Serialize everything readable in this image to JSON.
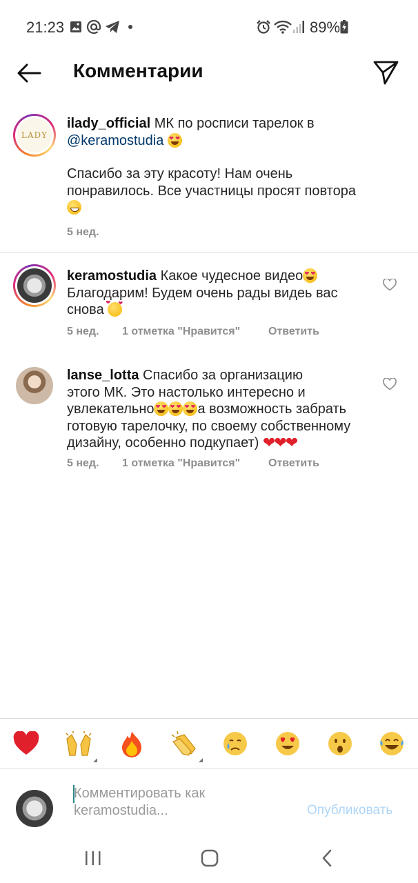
{
  "status_bar": {
    "time": "21:23",
    "battery": "89%",
    "icons": [
      "gallery-icon",
      "at-icon",
      "telegram-icon",
      "dot-icon",
      "alarm-icon",
      "wifi-icon",
      "signal-icon",
      "battery-icon"
    ]
  },
  "header": {
    "title": "Комментарии",
    "back_icon": "arrow-left-icon",
    "share_icon": "paper-plane-icon"
  },
  "caption": {
    "username": "ilady_official",
    "line1": "МК по росписи тарелок в",
    "mention": "@keramostudia",
    "body": "Спасибо за эту красоту! Нам очень понравилось. Все участницы просят повтора",
    "time": "5 нед.",
    "avatar_text": "LADY"
  },
  "comments": [
    {
      "username": "keramostudia",
      "text_line1": "Какое чудесное видео",
      "text_line2": "Благодарим! Будем очень рады видеь вас",
      "text_line3": "снова",
      "time": "5 нед.",
      "likes": "1 отметка \"Нравится\"",
      "reply": "Ответить"
    },
    {
      "username": "lanse_lotta",
      "text_line1": "Спасибо за организацию",
      "text_line2": "этого МК. Это настолько интересно и",
      "text_line3a": "увлекательно",
      "text_line3b": "а возможность забрать",
      "text_line4": "готовую тарелочку, по своему собственному",
      "text_line5": "дизайну, особенно подкупает)",
      "time": "5 нед.",
      "likes": "1 отметка \"Нравится\"",
      "reply": "Ответить"
    }
  ],
  "emoji_bar": [
    "❤️",
    "🙌",
    "🔥",
    "👏",
    "😢",
    "😍",
    "😮",
    "😂"
  ],
  "composer": {
    "placeholder": "Комментировать как keramostudia...",
    "publish": "Опубликовать"
  },
  "nav": [
    "recents-icon",
    "home-icon",
    "back-icon"
  ],
  "colors": {
    "mention": "#00376b",
    "meta": "#8e8e8e",
    "publish_disabled": "#aed6f8",
    "story_ring": "#dd2a7b"
  }
}
